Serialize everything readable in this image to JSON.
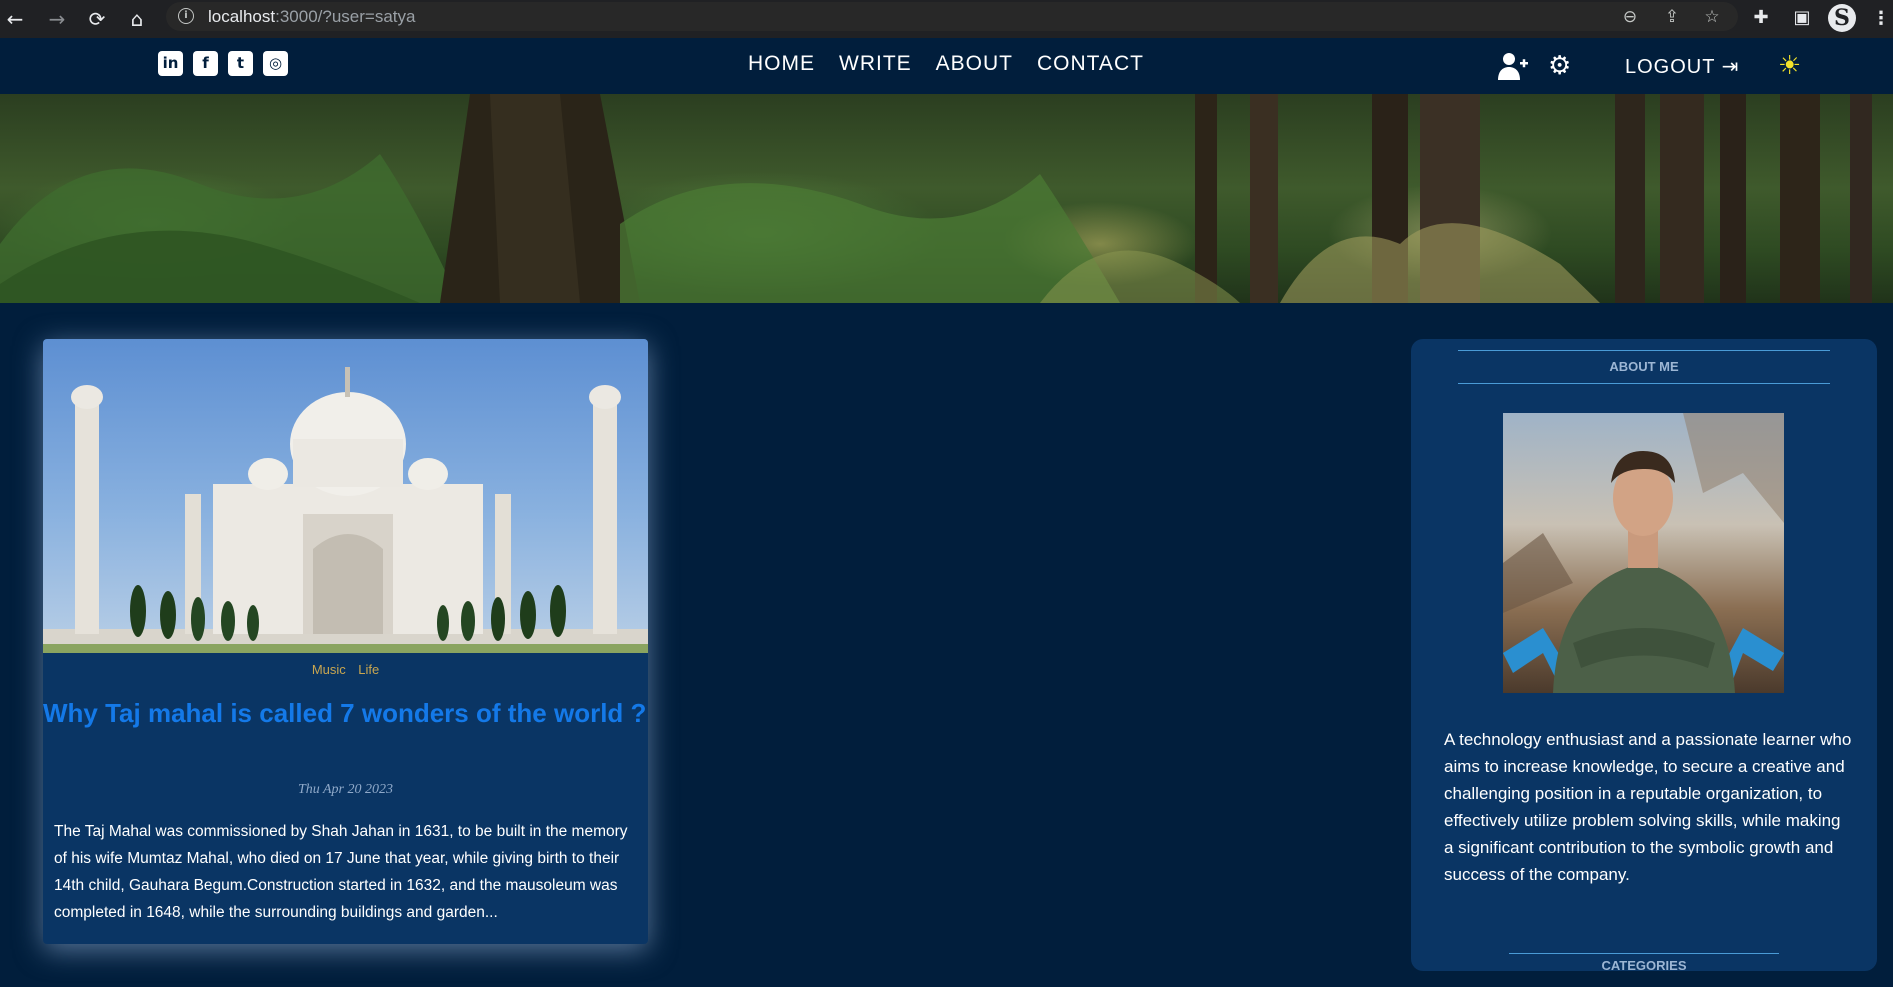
{
  "browser": {
    "url_host": "localhost",
    "url_rest": ":3000/?user=satya",
    "profile_letter": "S"
  },
  "social": {
    "icons": [
      "linkedin-icon",
      "facebook-icon",
      "twitter-icon",
      "instagram-icon"
    ],
    "glyphs": [
      "in",
      "f",
      "t",
      "◎"
    ]
  },
  "menu": {
    "items": [
      "HOME",
      "WRITE",
      "ABOUT",
      "CONTACT"
    ]
  },
  "topright": {
    "logout_label": "LOGOUT"
  },
  "post": {
    "categories": [
      "Music",
      "Life"
    ],
    "title": "Why Taj mahal is called 7 wonders of the world ?",
    "date": "Thu Apr 20 2023",
    "description": "The Taj Mahal was commissioned by Shah Jahan in 1631, to be built in the memory of his wife Mumtaz Mahal, who died on 17 June that year, while giving birth to their 14th child, Gauhara Begum.Construction started in 1632, and the mausoleum was completed in 1648, while the surrounding buildings and garden..."
  },
  "sidebar": {
    "about_title": "ABOUT ME",
    "bio": "A technology enthusiast and a passionate learner who aims to increase knowledge, to secure a creative and challenging position in a reputable organization, to effectively utilize problem solving skills, while making a significant contribution to the symbolic growth and success of the company.",
    "categories_title": "CATEGORIES"
  },
  "colors": {
    "page_bg": "#011e3c",
    "card_bg": "#0a3564",
    "title_blue": "#1479e8",
    "category_gold": "#c9a650",
    "sun_yellow": "#f4e32a"
  }
}
